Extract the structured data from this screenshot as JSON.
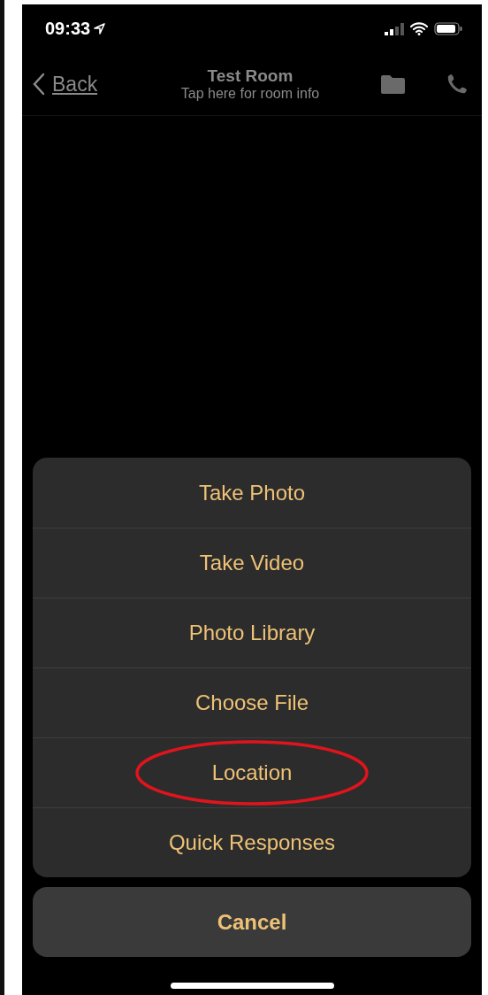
{
  "status_bar": {
    "time": "09:33"
  },
  "nav_bar": {
    "back": "Back",
    "title": "Test Room",
    "subtitle": "Tap here for room info"
  },
  "action_sheet": {
    "items": [
      {
        "label": "Take Photo",
        "highlighted": false
      },
      {
        "label": "Take Video",
        "highlighted": false
      },
      {
        "label": "Photo Library",
        "highlighted": false
      },
      {
        "label": "Choose File",
        "highlighted": false
      },
      {
        "label": "Location",
        "highlighted": true
      },
      {
        "label": "Quick Responses",
        "highlighted": false
      }
    ],
    "cancel": "Cancel"
  }
}
